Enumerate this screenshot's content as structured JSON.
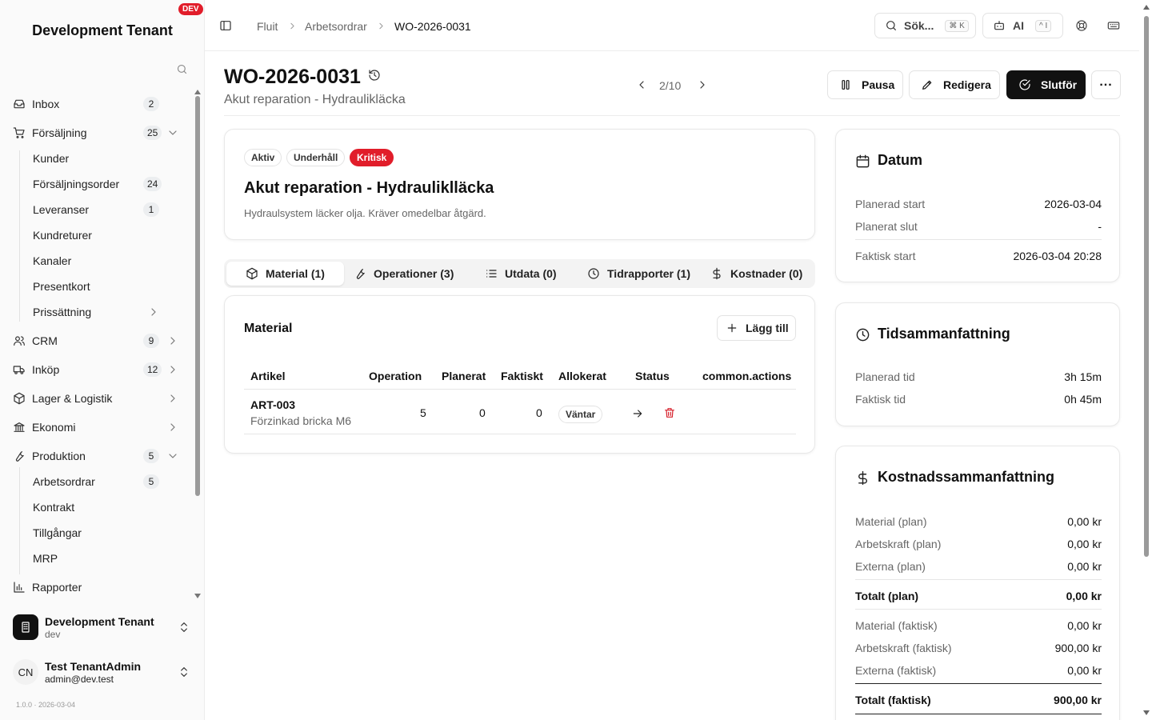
{
  "sidebar": {
    "tenant": "Development Tenant",
    "env_badge": "DEV",
    "items": [
      {
        "label": "Inbox",
        "count": "2",
        "icon": "inbox-icon"
      },
      {
        "label": "Försäljning",
        "count": "25",
        "icon": "cart-icon",
        "expanded": true
      },
      {
        "label": "Kunder"
      },
      {
        "label": "Försäljningsorder",
        "count": "24"
      },
      {
        "label": "Leveranser",
        "count": "1"
      },
      {
        "label": "Kundreturer"
      },
      {
        "label": "Kanaler"
      },
      {
        "label": "Presentkort"
      },
      {
        "label": "Prissättning"
      },
      {
        "label": "CRM",
        "count": "9",
        "icon": "users-icon"
      },
      {
        "label": "Inköp",
        "count": "12",
        "icon": "truck-icon"
      },
      {
        "label": "Lager & Logistik",
        "icon": "package-icon"
      },
      {
        "label": "Ekonomi",
        "icon": "bank-icon"
      },
      {
        "label": "Produktion",
        "count": "5",
        "icon": "wrench-icon",
        "expanded": true
      },
      {
        "label": "Arbetsordrar",
        "count": "5"
      },
      {
        "label": "Kontrakt"
      },
      {
        "label": "Tillgångar"
      },
      {
        "label": "MRP"
      },
      {
        "label": "Rapporter",
        "icon": "chart-icon"
      }
    ],
    "org": {
      "name": "Development Tenant",
      "slug": "dev"
    },
    "user": {
      "initials": "CN",
      "name": "Test TenantAdmin",
      "email": "admin@dev.test"
    },
    "version": "1.0.0 · 2026-03-04"
  },
  "topbar": {
    "breadcrumbs": [
      "Fluit",
      "Arbetsordrar",
      "WO-2026-0031"
    ],
    "search_label": "Sök...",
    "search_kbd": "⌘ K",
    "ai_label": "AI",
    "ai_kbd": "^ I"
  },
  "header": {
    "title": "WO-2026-0031",
    "subtitle": "Akut reparation - Hydraulikläcka",
    "pager": "2/10",
    "actions": {
      "pause": "Pausa",
      "edit": "Redigera",
      "complete": "Slutför"
    }
  },
  "info": {
    "badges": [
      "Aktiv",
      "Underhåll",
      "Kritisk"
    ],
    "title": "Akut reparation - Hydrauliklläcka",
    "description": "Hydraulsystem läcker olja. Kräver omedelbar åtgärd."
  },
  "tabs": [
    "Material (1)",
    "Operationer (3)",
    "Utdata (0)",
    "Tidrapporter (1)",
    "Kostnader (0)"
  ],
  "material": {
    "title": "Material",
    "add_label": "Lägg till",
    "columns": [
      "Artikel",
      "Operation",
      "Planerat",
      "Faktiskt",
      "Allokerat",
      "Status",
      "common.actions"
    ],
    "rows": [
      {
        "article": "ART-003",
        "description": "Förzinkad bricka M6",
        "operation": "5",
        "planned": "0",
        "actual": "0",
        "allocated": "Väntar"
      }
    ]
  },
  "dates": {
    "title": "Datum",
    "rows": [
      {
        "label": "Planerad start",
        "value": "2026-03-04"
      },
      {
        "label": "Planerat slut",
        "value": "-"
      },
      {
        "label": "Faktisk start",
        "value": "2026-03-04 20:28"
      }
    ]
  },
  "time": {
    "title": "Tidsammanfattning",
    "rows": [
      {
        "label": "Planerad tid",
        "value": "3h 15m"
      },
      {
        "label": "Faktisk tid",
        "value": "0h 45m"
      }
    ]
  },
  "cost": {
    "title": "Kostnadssammanfattning",
    "rows": [
      {
        "label": "Material (plan)",
        "value": "0,00 kr"
      },
      {
        "label": "Arbetskraft (plan)",
        "value": "0,00 kr"
      },
      {
        "label": "Externa (plan)",
        "value": "0,00 kr"
      },
      {
        "label": "Totalt (plan)",
        "value": "0,00 kr"
      },
      {
        "label": "Material (faktisk)",
        "value": "0,00 kr"
      },
      {
        "label": "Arbetskraft (faktisk)",
        "value": "900,00 kr"
      },
      {
        "label": "Externa (faktisk)",
        "value": "0,00 kr"
      },
      {
        "label": "Totalt (faktisk)",
        "value": "900,00 kr"
      }
    ]
  },
  "colors": {
    "accent": "#111111",
    "critical": "#e11d2a",
    "delete": "#d6202b"
  }
}
